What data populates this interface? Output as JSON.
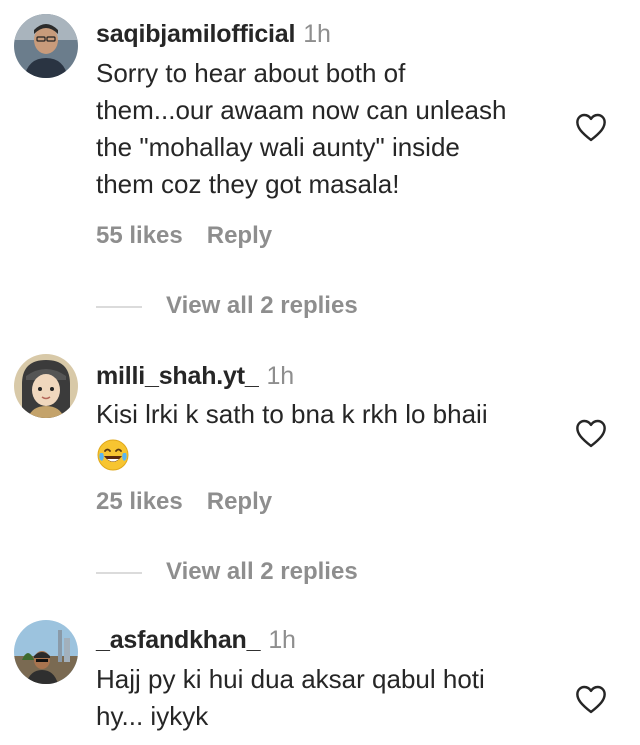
{
  "comments": [
    {
      "username": "saqibjamilofficial",
      "time": "1h",
      "lines": [
        "Sorry to hear about both of",
        "them...our awaam now can unleash",
        "the \"mohallay wali aunty\" inside",
        "them coz they got masala!"
      ],
      "likes": "55 likes",
      "reply_label": "Reply",
      "view_replies": "View all 2 replies"
    },
    {
      "username": "milli_shah.yt_",
      "time": "1h",
      "lines": [
        "Kisi lrki k sath to bna k rkh lo bhaii"
      ],
      "emoji": "face-with-tears-of-joy-icon",
      "likes": "25 likes",
      "reply_label": "Reply",
      "view_replies": "View all 2 replies"
    },
    {
      "username": "_asfandkhan_",
      "time": "1h",
      "lines": [
        "Hajj py ki hui dua aksar qabul hoti",
        "hy... iykyk"
      ]
    }
  ],
  "colors": {
    "text": "#262626",
    "secondary": "#8e8e8e",
    "divider": "#dbdbdb"
  }
}
